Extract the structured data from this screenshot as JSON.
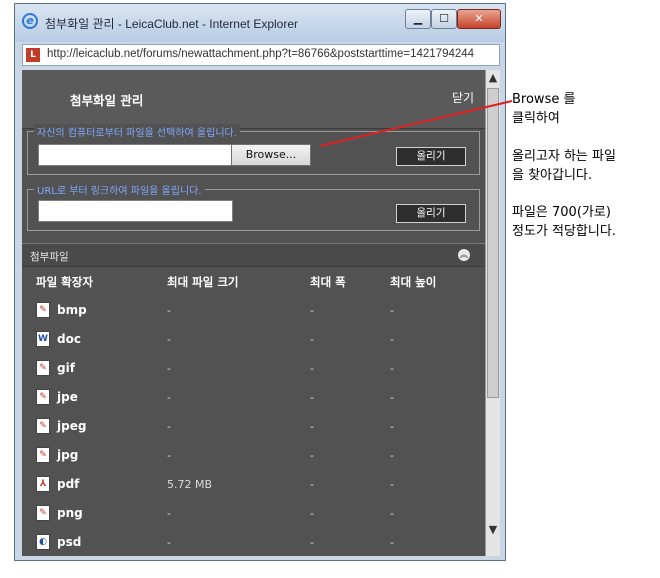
{
  "window": {
    "title": "첨부화일 관리 - LeicaClub.net - Internet Explorer",
    "url": "http://leicaclub.net/forums/newattachment.php?t=86766&poststarttime=1421794244"
  },
  "header": {
    "title": "첨부화일 관리",
    "close_label": "닫기"
  },
  "upload_local": {
    "legend": "자신의 컴퓨터로부터 파일을 선택하여 올립니다.",
    "browse_label": "Browse...",
    "upload_label": "올리기"
  },
  "upload_url": {
    "legend": "URL로 부터 링크하여 파일을 올립니다.",
    "upload_label": "올리기"
  },
  "attachments": {
    "title": "첨부파일",
    "columns": [
      "파일 확장자",
      "최대 파일 크기",
      "최대 폭",
      "최대 높이"
    ],
    "rows": [
      {
        "ext": "bmp",
        "size": "-",
        "width": "-",
        "height": "-"
      },
      {
        "ext": "doc",
        "size": "-",
        "width": "-",
        "height": "-"
      },
      {
        "ext": "gif",
        "size": "-",
        "width": "-",
        "height": "-"
      },
      {
        "ext": "jpe",
        "size": "-",
        "width": "-",
        "height": "-"
      },
      {
        "ext": "jpeg",
        "size": "-",
        "width": "-",
        "height": "-"
      },
      {
        "ext": "jpg",
        "size": "-",
        "width": "-",
        "height": "-"
      },
      {
        "ext": "pdf",
        "size": "5.72 MB",
        "width": "-",
        "height": "-"
      },
      {
        "ext": "png",
        "size": "-",
        "width": "-",
        "height": "-"
      },
      {
        "ext": "psd",
        "size": "-",
        "width": "-",
        "height": "-"
      }
    ]
  },
  "annotation": {
    "line1": "Browse 를",
    "line2": "클릭하여",
    "line3": "올리고자 하는 파일",
    "line4": "을 찾아갑니다.",
    "line5": "파일은 700(가로)",
    "line6": "정도가 적당합니다.",
    "arrow_color": "#e02020"
  }
}
